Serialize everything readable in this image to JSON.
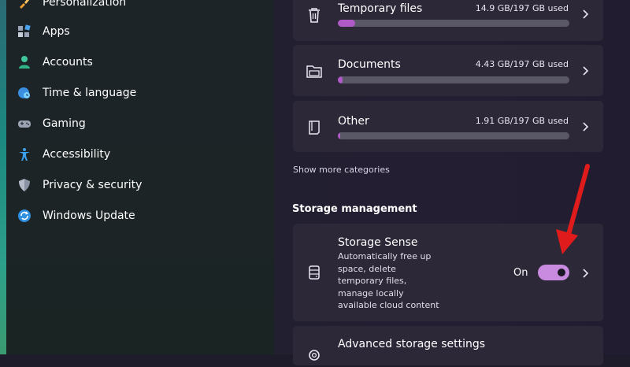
{
  "sidebar": {
    "items": [
      {
        "label": "Personalization",
        "icon": "brush-icon"
      },
      {
        "label": "Apps",
        "icon": "apps-icon"
      },
      {
        "label": "Accounts",
        "icon": "person-icon"
      },
      {
        "label": "Time & language",
        "icon": "globe-clock-icon"
      },
      {
        "label": "Gaming",
        "icon": "gamepad-icon"
      },
      {
        "label": "Accessibility",
        "icon": "accessibility-icon"
      },
      {
        "label": "Privacy & security",
        "icon": "shield-icon"
      },
      {
        "label": "Windows Update",
        "icon": "update-icon"
      }
    ]
  },
  "storage": {
    "categories": [
      {
        "title": "Temporary files",
        "used": "14.9 GB/197 GB used",
        "fraction": 0.076,
        "icon": "trash-icon"
      },
      {
        "title": "Documents",
        "used": "4.43 GB/197 GB used",
        "fraction": 0.022,
        "icon": "folder-icon"
      },
      {
        "title": "Other",
        "used": "1.91 GB/197 GB used",
        "fraction": 0.01,
        "icon": "file-icon"
      }
    ],
    "show_more": "Show more categories"
  },
  "management": {
    "heading": "Storage management",
    "sense": {
      "title": "Storage Sense",
      "description_lines": [
        "Automatically free up",
        "space, delete",
        "temporary files,",
        "manage locally",
        "available cloud content"
      ],
      "state": "On",
      "enabled": true
    },
    "advanced": {
      "title": "Advanced storage settings"
    }
  },
  "colors": {
    "accent": "#c98be0",
    "bar_fill": "#b05ac8",
    "annotation_arrow": "#e01b1b"
  }
}
